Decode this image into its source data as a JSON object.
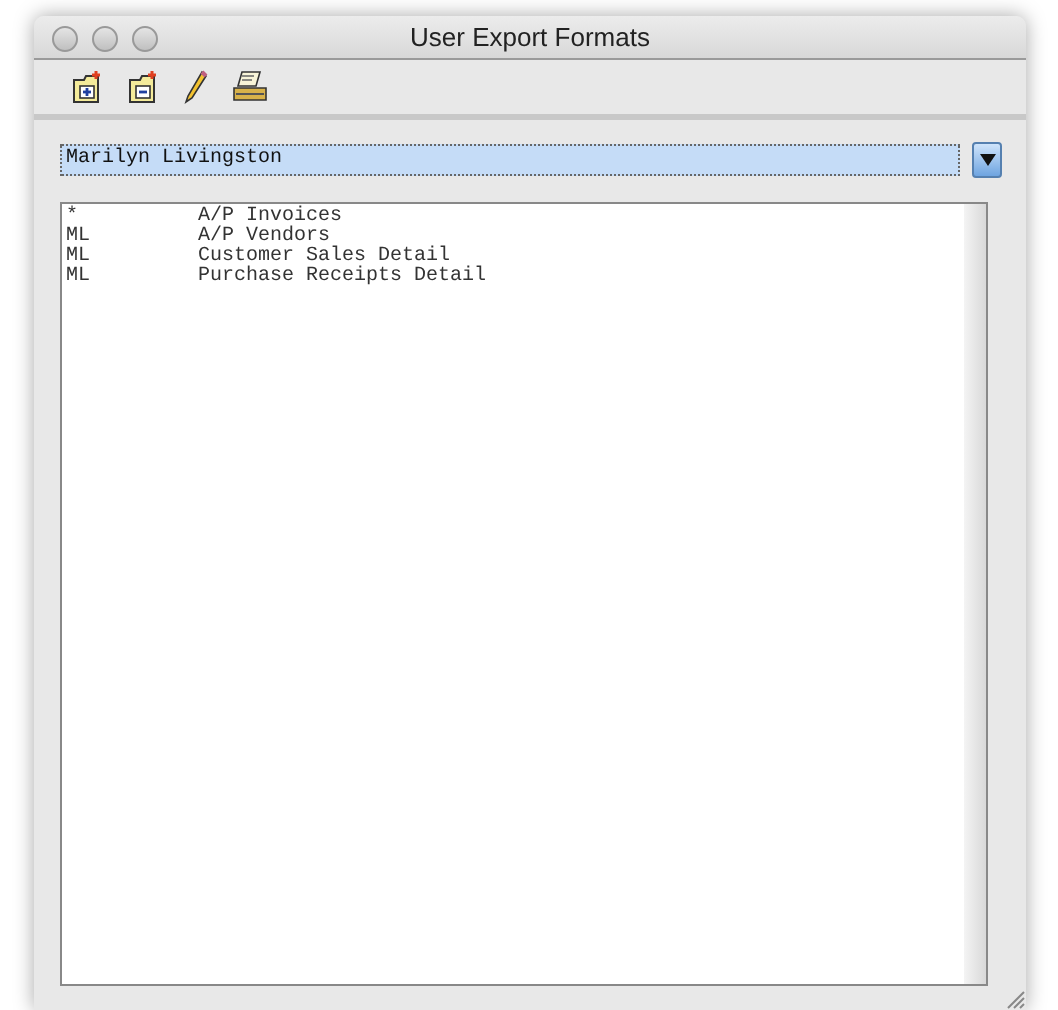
{
  "window": {
    "title": "User Export Formats"
  },
  "toolbar": {
    "buttons": [
      {
        "kind": "add"
      },
      {
        "kind": "remove"
      },
      {
        "kind": "edit"
      },
      {
        "kind": "print"
      }
    ]
  },
  "user_dropdown": {
    "value": "Marilyn Livingston"
  },
  "formats": [
    {
      "owner": "*",
      "name": "A/P Invoices"
    },
    {
      "owner": "ML",
      "name": "A/P Vendors"
    },
    {
      "owner": "ML",
      "name": "Customer Sales Detail"
    },
    {
      "owner": "ML",
      "name": "Purchase Receipts Detail"
    }
  ]
}
